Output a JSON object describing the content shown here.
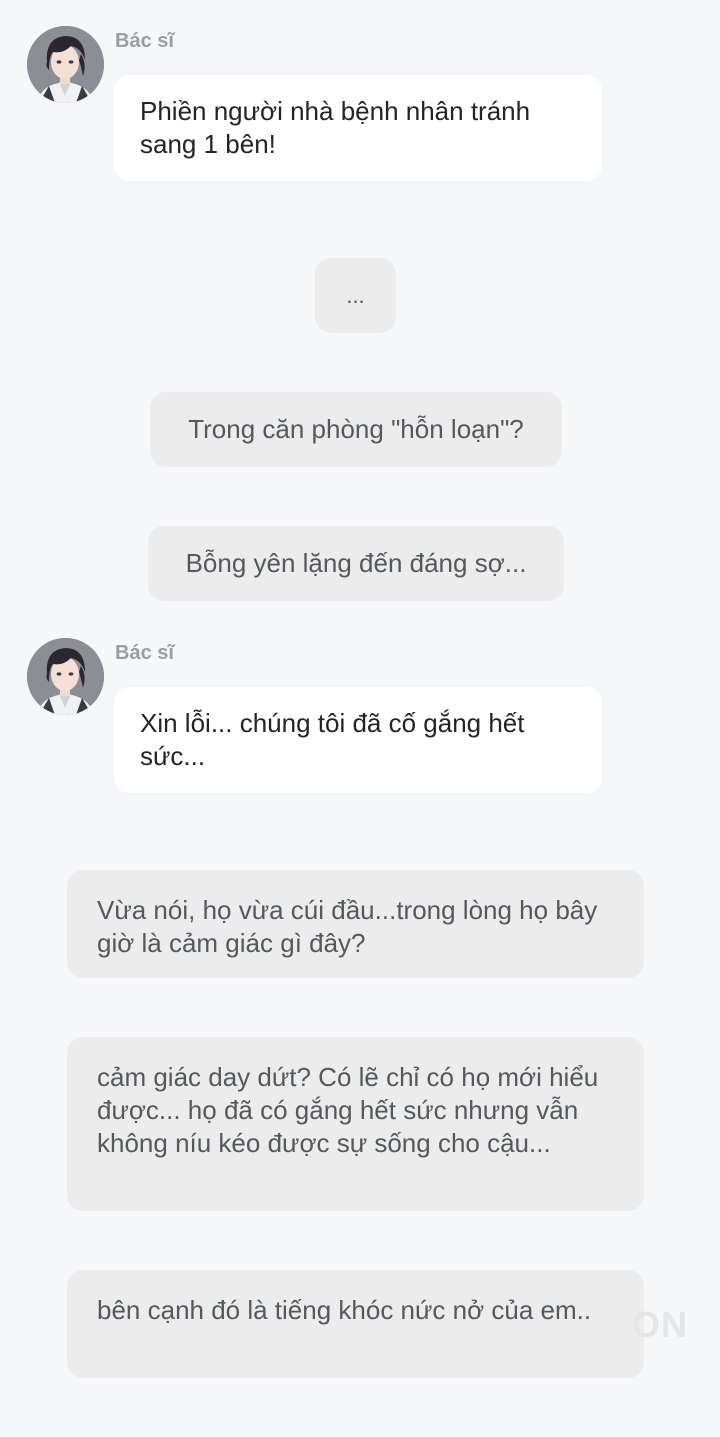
{
  "messages": [
    {
      "speaker": "Bác sĩ",
      "text": "Phiền người nhà bệnh nhân tránh sang 1 bên!"
    },
    {
      "text": "..."
    },
    {
      "text": "Trong căn phòng \"hỗn loạn\"?"
    },
    {
      "text": "Bỗng yên lặng đến đáng sợ..."
    },
    {
      "speaker": "Bác sĩ",
      "text": "Xin lỗi... chúng tôi đã cố gắng hết sức..."
    },
    {
      "text": "Vừa nói, họ vừa cúi đầu...trong lòng họ bây giờ là cảm giác gì đây?"
    },
    {
      "text": "cảm giác day dứt? Có lẽ chỉ có họ mới hiểu được... họ đã có gắng hết sức nhưng vẫn không níu kéo được sự sống cho cậu..."
    },
    {
      "text": "bên cạnh đó là tiếng khóc nức nở của em.."
    }
  ],
  "watermark": "ON",
  "colors": {
    "background": "#f5f7f9",
    "speaker_bubble": "#ffffff",
    "narration_bubble": "#ececec",
    "speaker_name": "#9a9ea4"
  },
  "icons": {
    "avatar": "doctor-avatar-icon"
  }
}
